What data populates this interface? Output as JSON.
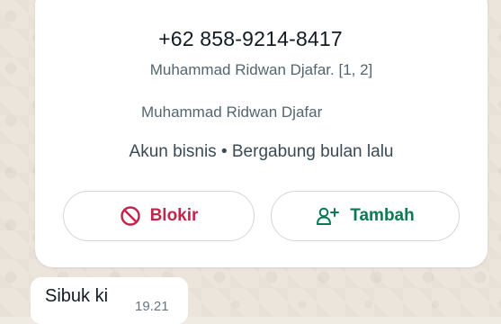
{
  "contact": {
    "phone": "+62 858-9214-8417",
    "push_name": "Muhammad Ridwan Djafar. [1, 2]",
    "saved_name": "Muhammad Ridwan Djafar",
    "business_info": "Akun bisnis • Bergabung bulan lalu"
  },
  "actions": {
    "block_label": "Blokir",
    "add_label": "Tambah",
    "block_icon": "block-icon",
    "add_icon": "add-contact-icon"
  },
  "message": {
    "text": "Sibuk ki",
    "time": "19.21"
  },
  "colors": {
    "block": "#c0264a",
    "add": "#0a7a52",
    "card": "#ffffff",
    "wallpaper": "#ece5dc"
  }
}
